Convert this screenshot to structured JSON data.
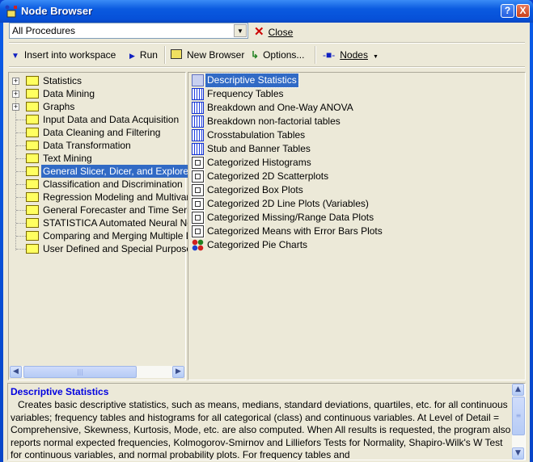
{
  "window": {
    "title": "Node Browser",
    "help_label": "?",
    "close_label": "X"
  },
  "toolbar": {
    "filter_value": "All Procedures",
    "close_label": "Close",
    "insert_label": "Insert into workspace",
    "run_label": "Run",
    "new_browser_label": "New Browser",
    "options_label": "Options...",
    "nodes_label": "Nodes"
  },
  "tree": [
    {
      "label": "Statistics",
      "expandable": true
    },
    {
      "label": "Data Mining",
      "expandable": true
    },
    {
      "label": "Graphs",
      "expandable": true
    },
    {
      "label": "Input Data and Data Acquisition"
    },
    {
      "label": "Data Cleaning and Filtering"
    },
    {
      "label": "Data Transformation"
    },
    {
      "label": "Text Mining"
    },
    {
      "label": "General Slicer, Dicer, and Explorer",
      "selected": true
    },
    {
      "label": "Classification and Discrimination"
    },
    {
      "label": "Regression Modeling and Multivariate"
    },
    {
      "label": "General Forecaster and Time Series"
    },
    {
      "label": "STATISTICA Automated Neural Netw"
    },
    {
      "label": "Comparing and Merging Multiple Data"
    },
    {
      "label": "User Defined and Special Purpose M"
    }
  ],
  "nodes": [
    {
      "label": "Descriptive Statistics",
      "selected": true
    },
    {
      "label": "Frequency Tables"
    },
    {
      "label": "Breakdown and One-Way ANOVA"
    },
    {
      "label": "Breakdown non-factorial tables"
    },
    {
      "label": "Crosstabulation Tables"
    },
    {
      "label": "Stub and Banner Tables"
    },
    {
      "label": "Categorized Histograms"
    },
    {
      "label": "Categorized 2D Scatterplots"
    },
    {
      "label": "Categorized Box Plots"
    },
    {
      "label": "Categorized 2D Line Plots (Variables)"
    },
    {
      "label": "Categorized Missing/Range Data Plots"
    },
    {
      "label": "Categorized Means with Error Bars Plots"
    },
    {
      "label": "Categorized Pie Charts"
    }
  ],
  "description": {
    "title": "Descriptive Statistics",
    "text": "Creates basic descriptive statistics, such as means, medians, standard deviations, quartiles, etc. for all continuous variables; frequency tables and histograms for all categorical (class) and continuous variables. At Level of Detail = Comprehensive, Skewness, Kurtosis, Mode, etc. are also computed. When All results is requested, the program also reports normal expected frequencies, Kolmogorov-Smirnov and Lilliefors Tests for Normality, Shapiro-Wilk's W Test for continuous variables,  and normal probability plots. For frequency tables and"
  }
}
